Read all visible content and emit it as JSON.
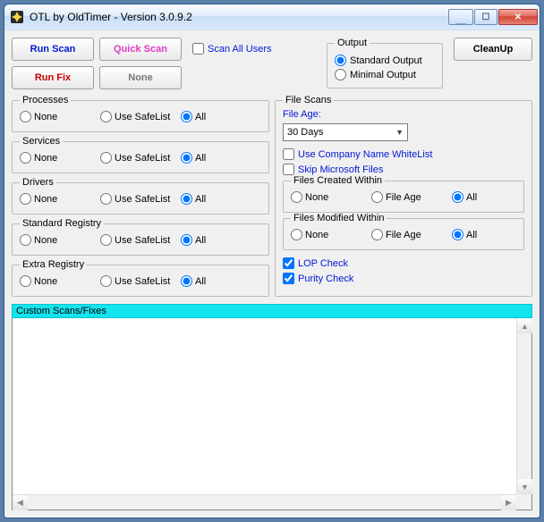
{
  "window": {
    "title": "OTL by OldTimer - Version 3.0.9.2"
  },
  "buttons": {
    "run_scan": "Run Scan",
    "quick_scan": "Quick Scan",
    "run_fix": "Run Fix",
    "none": "None",
    "cleanup": "CleanUp"
  },
  "scan_all_users": {
    "label": "Scan All Users",
    "checked": false
  },
  "output_group": {
    "legend": "Output",
    "standard": "Standard Output",
    "minimal": "Minimal Output",
    "selected": "standard"
  },
  "left_groups": [
    {
      "legend": "Processes",
      "none": "None",
      "safelist": "Use SafeList",
      "all": "All",
      "selected": "all"
    },
    {
      "legend": "Services",
      "none": "None",
      "safelist": "Use SafeList",
      "all": "All",
      "selected": "all"
    },
    {
      "legend": "Drivers",
      "none": "None",
      "safelist": "Use SafeList",
      "all": "All",
      "selected": "all"
    },
    {
      "legend": "Standard Registry",
      "none": "None",
      "safelist": "Use SafeList",
      "all": "All",
      "selected": "all"
    },
    {
      "legend": "Extra Registry",
      "none": "None",
      "safelist": "Use SafeList",
      "all": "All",
      "selected": "all"
    }
  ],
  "file_scans": {
    "legend": "File Scans",
    "file_age_label": "File Age:",
    "file_age_value": "30 Days",
    "whitelist": {
      "label": "Use Company Name WhiteList",
      "checked": false
    },
    "skip_ms": {
      "label": "Skip Microsoft Files",
      "checked": false
    },
    "created": {
      "legend": "Files Created Within",
      "none": "None",
      "fileage": "File Age",
      "all": "All",
      "selected": "all"
    },
    "modified": {
      "legend": "Files Modified Within",
      "none": "None",
      "fileage": "File Age",
      "all": "All",
      "selected": "all"
    },
    "lop": {
      "label": "LOP Check",
      "checked": true
    },
    "purity": {
      "label": "Purity Check",
      "checked": true
    }
  },
  "custom": {
    "header": "Custom Scans/Fixes"
  }
}
